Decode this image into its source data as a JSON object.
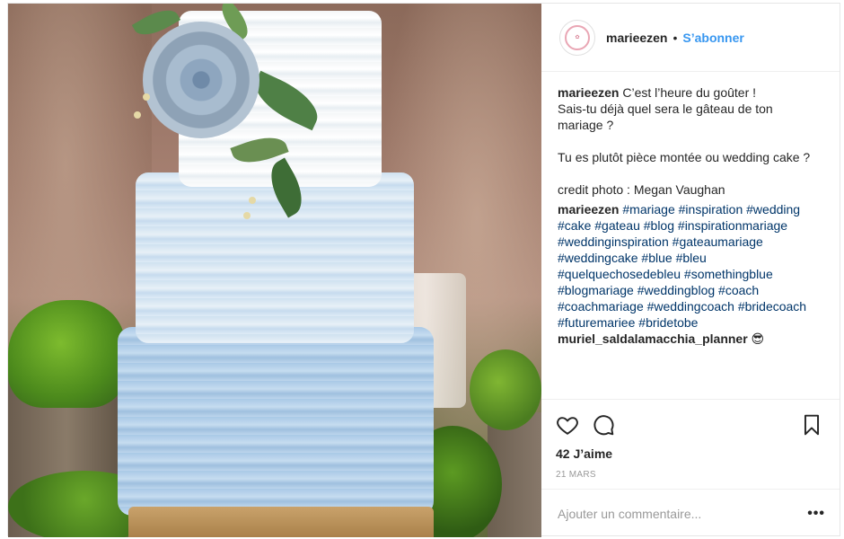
{
  "header": {
    "username": "marieezen",
    "separator": "•",
    "follow_label": "S’abonner"
  },
  "caption": {
    "username": "marieezen",
    "text": " C’est l’heure du goûter !\nSais-tu déjà quel sera le gâteau de ton mariage ?\n\nTu es plutôt pièce montée ou wedding cake ?\n\ncredit photo : Megan Vaughan"
  },
  "hashtag_comment": {
    "username": "marieezen",
    "tags": [
      "#mariage",
      "#inspiration",
      "#wedding",
      "#cake",
      "#gateau",
      "#blog",
      "#inspirationmariage",
      "#weddinginspiration",
      "#gateaumariage",
      "#weddingcake",
      "#blue",
      "#bleu",
      "#quelquechosedebleu",
      "#somethingblue",
      "#blogmariage",
      "#weddingblog",
      "#coach",
      "#coachmariage",
      "#weddingcoach",
      "#bridecoach",
      "#futuremariee",
      "#bridetobe"
    ]
  },
  "reply_comment": {
    "username": "muriel_saldalamacchia_planner",
    "text": " 😎"
  },
  "actions": {
    "like_icon": "heart-outline-icon",
    "comment_icon": "speech-bubble-icon",
    "save_icon": "bookmark-outline-icon",
    "likes": "42 J’aime",
    "date": "21 MARS"
  },
  "add_comment": {
    "placeholder": "Ajouter un commentaire...",
    "more_label": "•••"
  },
  "colors": {
    "link_blue": "#3897f0",
    "hashtag_blue": "#003569",
    "text": "#262626",
    "muted": "#999999"
  }
}
